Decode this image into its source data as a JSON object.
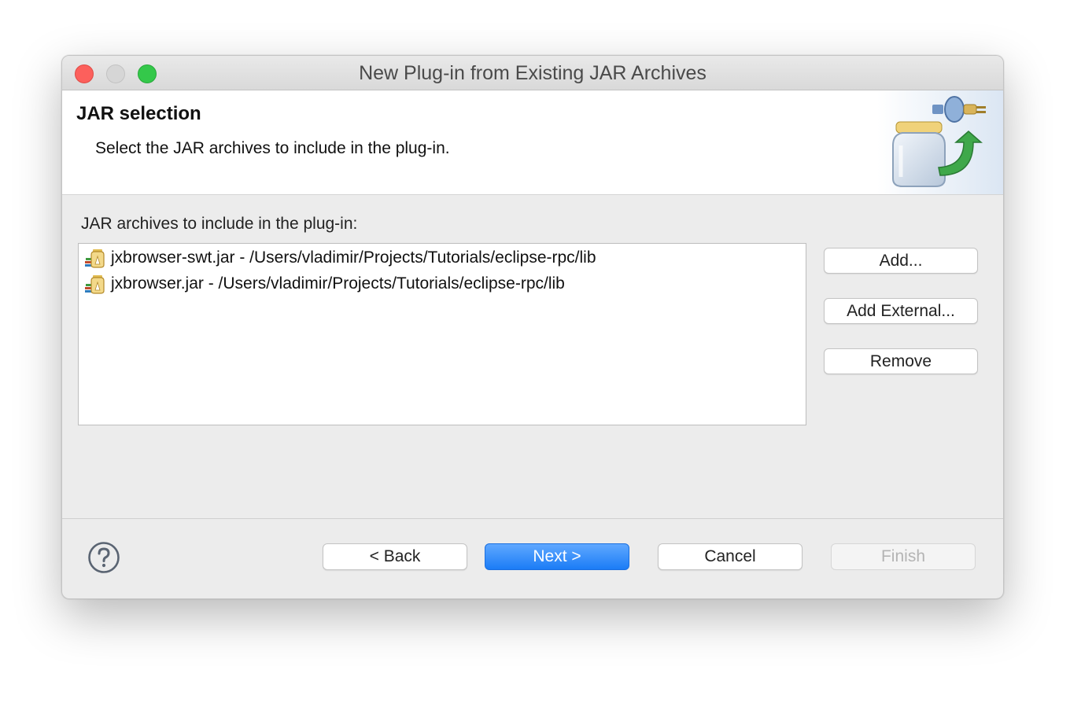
{
  "window": {
    "title": "New Plug-in from Existing JAR Archives"
  },
  "banner": {
    "title": "JAR selection",
    "description": "Select the JAR archives to include in the plug-in."
  },
  "list": {
    "label": "JAR archives to include in the plug-in:",
    "items": [
      {
        "text": "jxbrowser-swt.jar - /Users/vladimir/Projects/Tutorials/eclipse-rpc/lib",
        "icon": "jar-library-icon"
      },
      {
        "text": "jxbrowser.jar - /Users/vladimir/Projects/Tutorials/eclipse-rpc/lib",
        "icon": "jar-library-icon"
      }
    ]
  },
  "side_buttons": {
    "add": "Add...",
    "add_external": "Add External...",
    "remove": "Remove"
  },
  "footer": {
    "back": "< Back",
    "next": "Next >",
    "cancel": "Cancel",
    "finish": "Finish",
    "finish_enabled": false
  },
  "colors": {
    "primary_button": "#1b7cf6",
    "window_bg": "#ececec",
    "close": "#fc605c",
    "zoom": "#34c84a"
  }
}
